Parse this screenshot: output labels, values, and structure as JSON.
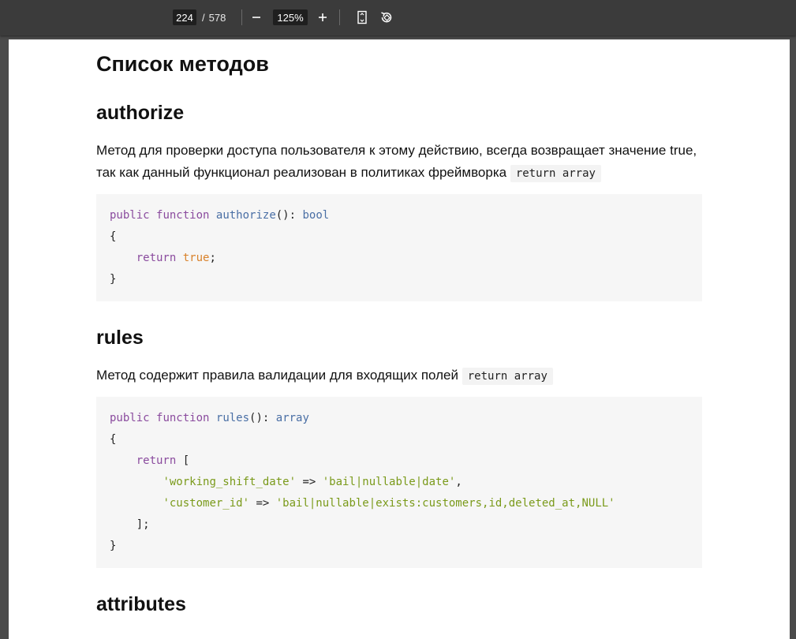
{
  "toolbar": {
    "page_current": "224",
    "page_separator": "/",
    "page_total": "578",
    "zoom_value": "125%",
    "zoom_out_icon": "minus-icon",
    "zoom_in_icon": "plus-icon",
    "fit_page_icon": "fit-page-icon",
    "rotate_icon": "rotate-icon"
  },
  "document": {
    "heading_main": "Список методов",
    "sections": [
      {
        "title": "authorize",
        "description": "Метод для проверки доступа пользователя к этому действию, всегда возвращает значение true, так как данный функционал реализован в политиках фреймворка",
        "inline_code": "return array",
        "code": {
          "sig_public": "public",
          "sig_function": "function",
          "sig_name": "authorize",
          "sig_paren": "(): ",
          "sig_type": "bool",
          "open_brace": "{",
          "return_kw": "return",
          "return_val": "true",
          "semicolon": ";",
          "close_brace": "}"
        }
      },
      {
        "title": "rules",
        "description": "Метод содержит правила валидации для входящих полей",
        "inline_code": "return array",
        "code": {
          "sig_public": "public",
          "sig_function": "function",
          "sig_name": "rules",
          "sig_paren": "(): ",
          "sig_type": "array",
          "open_brace": "{",
          "return_kw": "return",
          "return_open": " [",
          "entries": [
            {
              "key": "'working_shift_date'",
              "arrow": " => ",
              "value": "'bail|nullable|date'",
              "tail": ","
            },
            {
              "key": "'customer_id'",
              "arrow": " => ",
              "value": "'bail|nullable|exists:customers,id,deleted_at,NULL'",
              "tail": ""
            }
          ],
          "return_close": "];",
          "close_brace": "}"
        }
      },
      {
        "title": "attributes"
      }
    ]
  }
}
